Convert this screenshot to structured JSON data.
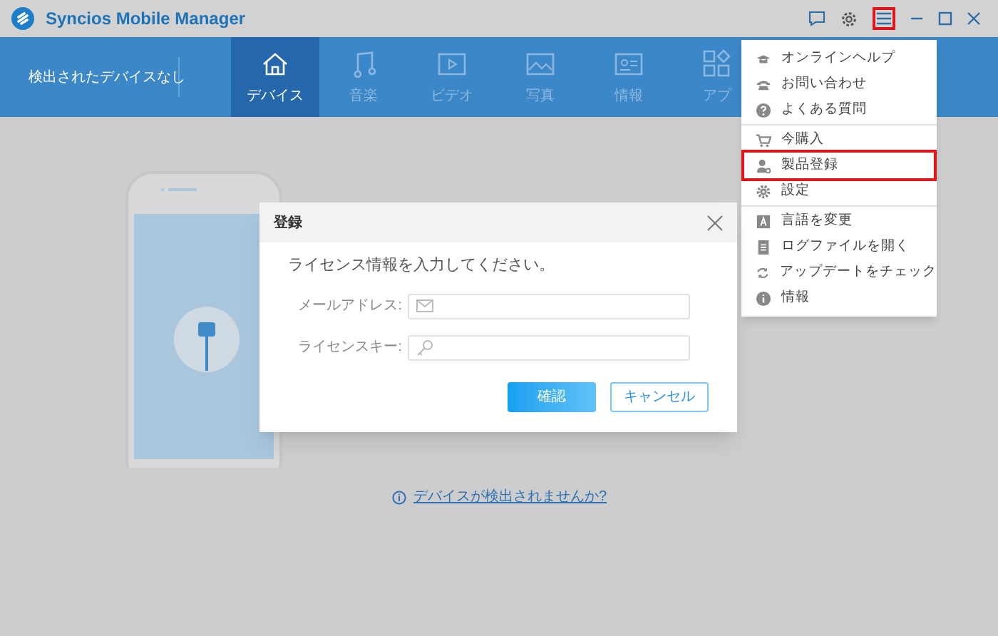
{
  "window": {
    "title": "Syncios Mobile Manager",
    "menu_button_highlighted": true
  },
  "device_status": "検出されたデバイスなし",
  "tabs": [
    {
      "label": "デバイス",
      "selected": true
    },
    {
      "label": "音楽",
      "selected": false
    },
    {
      "label": "ビデオ",
      "selected": false
    },
    {
      "label": "写真",
      "selected": false
    },
    {
      "label": "情報",
      "selected": false
    },
    {
      "label": "アプ",
      "selected": false
    }
  ],
  "background": {
    "help_link": "デバイスが検出されませんか?"
  },
  "menu": {
    "items": [
      {
        "label": "オンラインヘルプ",
        "highlighted": false,
        "separator_after": false
      },
      {
        "label": "お問い合わせ",
        "highlighted": false,
        "separator_after": false
      },
      {
        "label": "よくある質問",
        "highlighted": false,
        "separator_after": true
      },
      {
        "label": "今購入",
        "highlighted": false,
        "separator_after": false
      },
      {
        "label": "製品登録",
        "highlighted": true,
        "separator_after": false
      },
      {
        "label": "設定",
        "highlighted": false,
        "separator_after": true
      },
      {
        "label": "言語を変更",
        "highlighted": false,
        "separator_after": false
      },
      {
        "label": "ログファイルを開く",
        "highlighted": false,
        "separator_after": false
      },
      {
        "label": "アップデートをチェック",
        "highlighted": false,
        "separator_after": false
      },
      {
        "label": "情報",
        "highlighted": false,
        "separator_after": false
      }
    ]
  },
  "dialog": {
    "title": "登録",
    "prompt": "ライセンス情報を入力してください。",
    "fields": [
      {
        "label": "メールアドレス:"
      },
      {
        "label": "ライセンスキー:"
      }
    ],
    "buttons": [
      {
        "label": "確認",
        "kind": "primary"
      },
      {
        "label": "キャンセル",
        "kind": "secondary"
      }
    ]
  }
}
